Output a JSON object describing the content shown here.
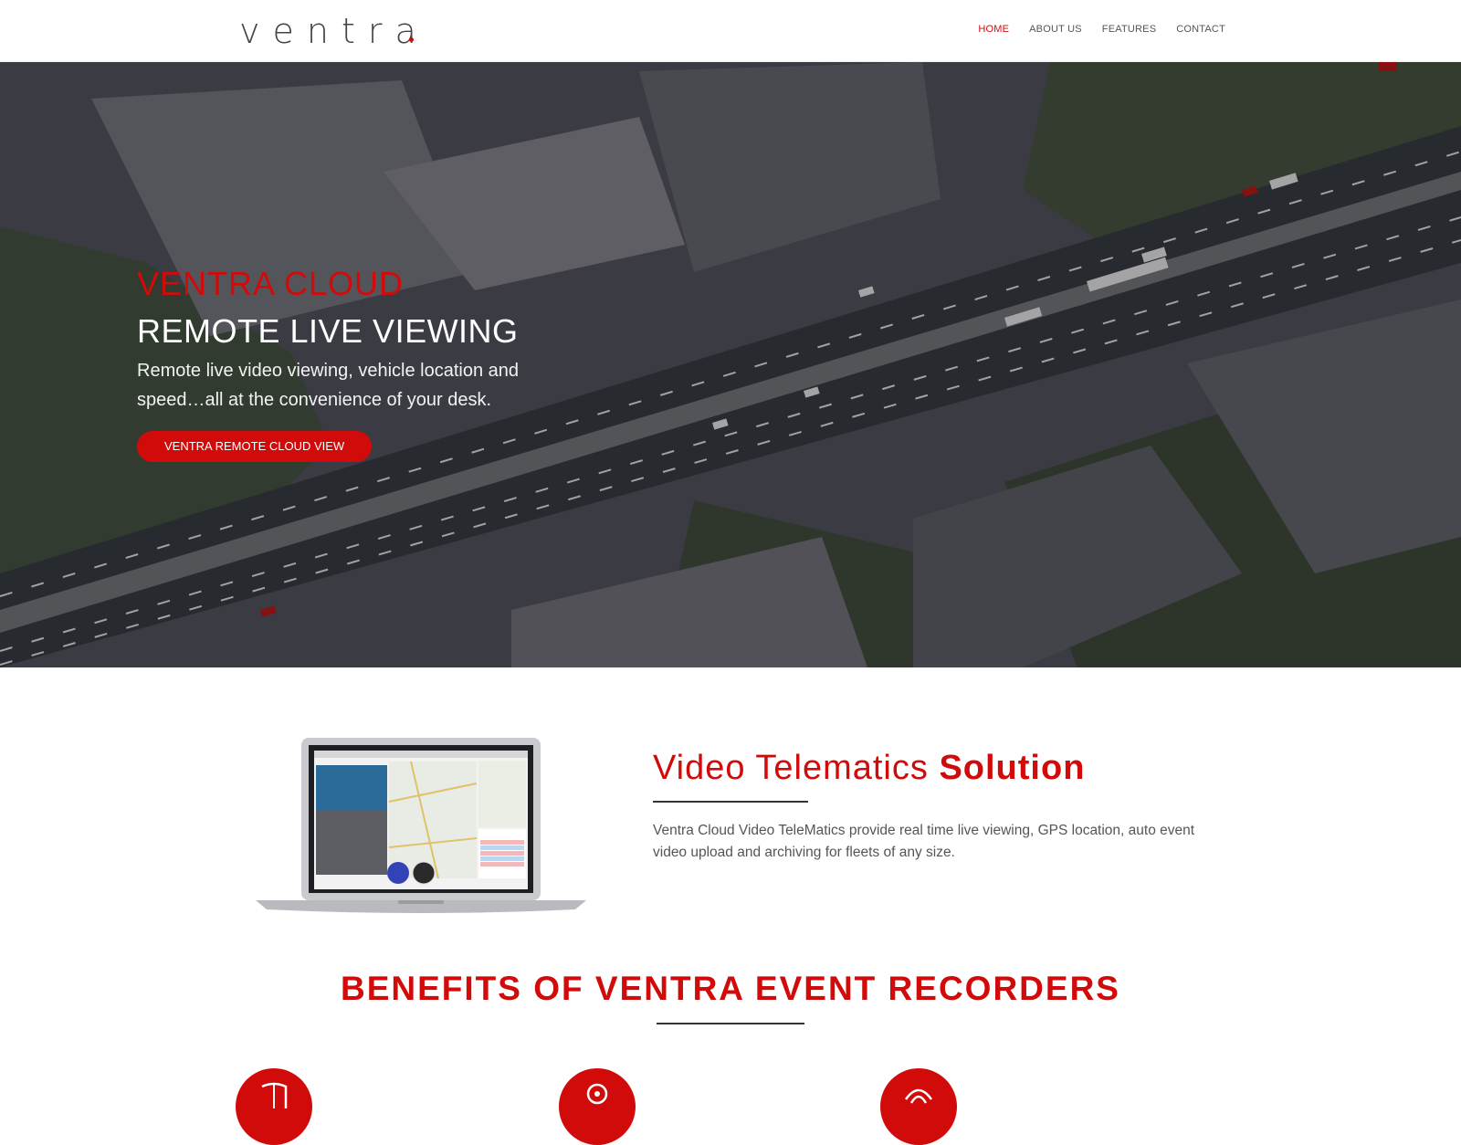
{
  "brand": {
    "logo_text": "ventra"
  },
  "nav": {
    "items": [
      {
        "label": "HOME",
        "active": true
      },
      {
        "label": "ABOUT US"
      },
      {
        "label": "FEATURES"
      },
      {
        "label": "CONTACT"
      }
    ]
  },
  "hero": {
    "kicker": "VENTRA CLOUD",
    "title": "REMOTE LIVE VIEWING",
    "subtitle": "Remote live video viewing, vehicle location and speed…all at the convenience of your desk.",
    "cta_label": "VENTRA REMOTE CLOUD VIEW"
  },
  "telematics": {
    "title_light": "Video Telematics",
    "title_bold": "Solution",
    "body": "Ventra Cloud Video TeleMatics provide real time live viewing, GPS location, auto event video upload and archiving for fleets of any size."
  },
  "benefits": {
    "title": "BENEFITS OF VENTRA EVENT RECORDERS"
  },
  "colors": {
    "accent": "#d10a0a",
    "text": "#555555",
    "hero_dark": "#3f4147"
  },
  "icons": [
    "shield-icon",
    "location-pin-icon",
    "wifi-signal-icon"
  ]
}
